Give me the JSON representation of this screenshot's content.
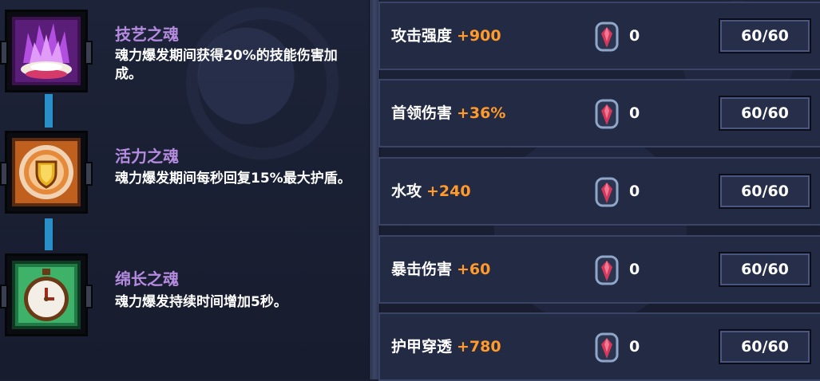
{
  "souls": [
    {
      "title": "技艺之魂",
      "description": "魂力爆发期间获得20%的技能伤害加成。",
      "icon": "purple-flame-icon"
    },
    {
      "title": "活力之魂",
      "description": "魂力爆发期间每秒回复15%最大护盾。",
      "icon": "shield-medallion-icon"
    },
    {
      "title": "绵长之魂",
      "description": "魂力爆发持续时间增加5秒。",
      "icon": "stopwatch-icon"
    }
  ],
  "stats": [
    {
      "name": "攻击强度",
      "value": "+900",
      "count": "0",
      "level": "60/60"
    },
    {
      "name": "首领伤害",
      "value": "+36%",
      "count": "0",
      "level": "60/60"
    },
    {
      "name": "水攻",
      "value": "+240",
      "count": "0",
      "level": "60/60"
    },
    {
      "name": "暴击伤害",
      "value": "+60",
      "count": "0",
      "level": "60/60"
    },
    {
      "name": "护甲穿透",
      "value": "+780",
      "count": "0",
      "level": "60/60"
    }
  ],
  "colors": {
    "accent_orange": "#ff9a2b",
    "soul_title": "#b58be0",
    "connector": "#2a8fc8"
  }
}
